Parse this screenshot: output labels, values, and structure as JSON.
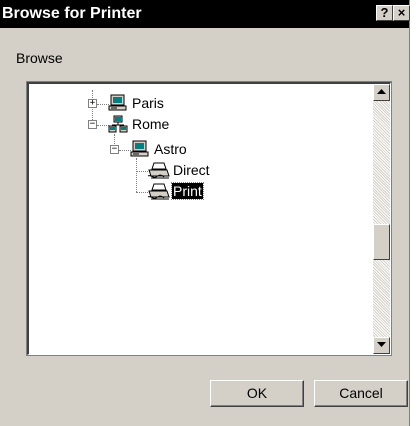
{
  "window": {
    "title": "Browse for Printer",
    "help_label": "?",
    "close_label": "×"
  },
  "browse_label": "Browse",
  "tree": {
    "nodes": [
      {
        "label": "Paris",
        "icon": "computer-icon",
        "expanded": false
      },
      {
        "label": "Rome",
        "icon": "network-group-icon",
        "expanded": true
      },
      {
        "label": "Astro",
        "icon": "computer-icon",
        "expanded": true
      },
      {
        "label": "Direct",
        "icon": "printer-icon"
      },
      {
        "label": "Print",
        "icon": "printer-icon",
        "selected": true
      }
    ],
    "expand_symbol": "+",
    "collapse_symbol": "−"
  },
  "buttons": {
    "ok": "OK",
    "cancel": "Cancel"
  }
}
